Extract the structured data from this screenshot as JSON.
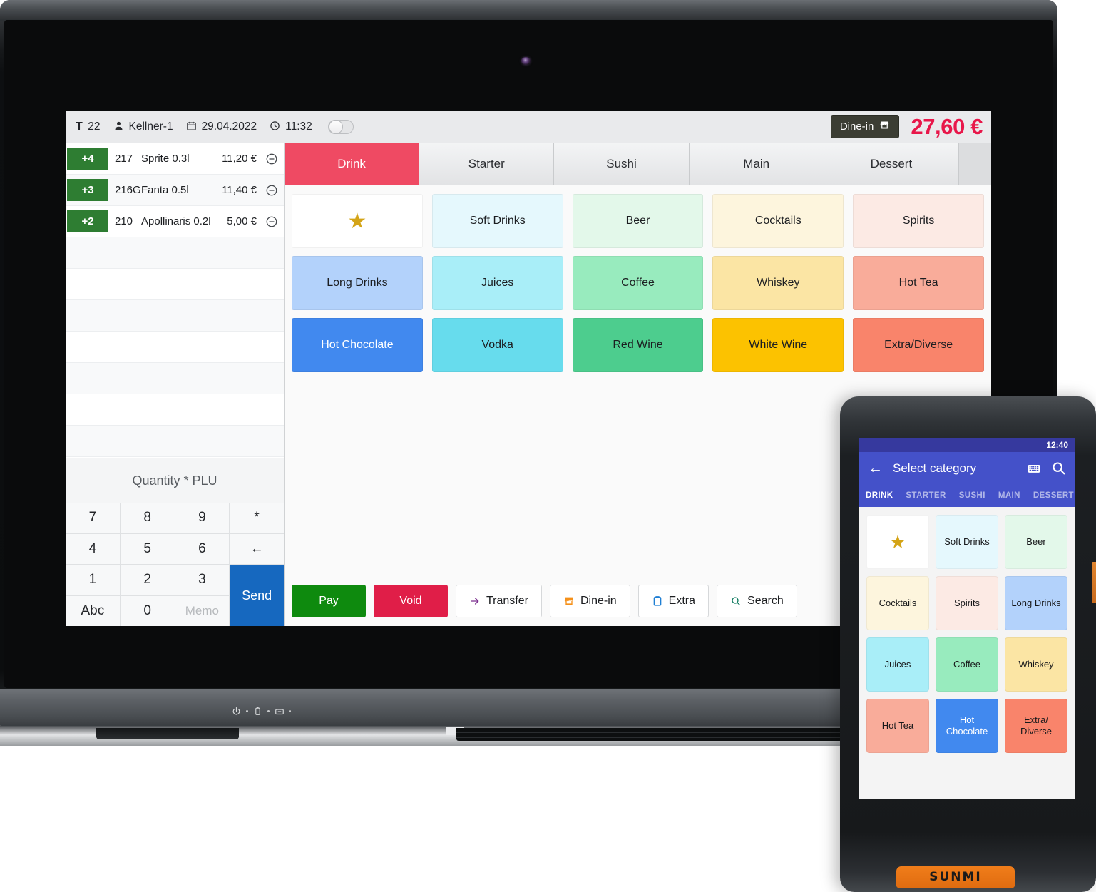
{
  "pos": {
    "header": {
      "table_label": "T",
      "table_number": "22",
      "waiter": "Kellner-1",
      "date": "29.04.2022",
      "time": "11:32",
      "toggle_state": "off",
      "order_type_badge": "Dine-in",
      "total": "27,60 €",
      "total_color": "#e8174a"
    },
    "order_items": [
      {
        "qty": "+4",
        "plu": "217",
        "name": "Sprite 0.3l",
        "price": "11,20 €"
      },
      {
        "qty": "+3",
        "plu": "216G",
        "name": "Fanta 0.5l",
        "price": "11,40 €"
      },
      {
        "qty": "+2",
        "plu": "210",
        "name": "Apollinaris 0.2l",
        "price": "5,00 €"
      }
    ],
    "empty_row_count": 7,
    "keypad": {
      "label": "Quantity * PLU",
      "keys": [
        "7",
        "8",
        "9",
        "*",
        "4",
        "5",
        "6",
        "←",
        "1",
        "2",
        "3",
        "Abc",
        "0",
        "Memo"
      ],
      "send_label": "Send",
      "send_color": "#1668bf",
      "muted_key": "Memo"
    },
    "category_tabs": [
      {
        "label": "Drink",
        "active": true
      },
      {
        "label": "Starter",
        "active": false
      },
      {
        "label": "Sushi",
        "active": false
      },
      {
        "label": "Main",
        "active": false
      },
      {
        "label": "Dessert",
        "active": false
      }
    ],
    "active_tab_color": "#ef4a63",
    "products": [
      {
        "label": "★",
        "icon": "star-icon",
        "color": "#ffffff",
        "is_star": true
      },
      {
        "label": "Soft Drinks",
        "color": "#e5f8fd"
      },
      {
        "label": "Beer",
        "color": "#e3f8ea"
      },
      {
        "label": "Cocktails",
        "color": "#fdf5dd"
      },
      {
        "label": "Spirits",
        "color": "#fceae4"
      },
      {
        "label": "Long Drinks",
        "color": "#b3d2fb"
      },
      {
        "label": "Juices",
        "color": "#a9eef8"
      },
      {
        "label": "Coffee",
        "color": "#98ebbe"
      },
      {
        "label": "Whiskey",
        "color": "#fbe5a4"
      },
      {
        "label": "Hot Tea",
        "color": "#f9ac9a"
      },
      {
        "label": "Hot Chocolate",
        "color": "#4189ef",
        "text_color": "#ffffff"
      },
      {
        "label": "Vodka",
        "color": "#67dced"
      },
      {
        "label": "Red Wine",
        "color": "#4dcd8e"
      },
      {
        "label": "White Wine",
        "color": "#fcc200"
      },
      {
        "label": "Extra/Diverse",
        "color": "#f9846b"
      }
    ],
    "actions": [
      {
        "label": "Pay",
        "style": "pay",
        "icon": ""
      },
      {
        "label": "Void",
        "style": "void",
        "icon": ""
      },
      {
        "label": "Transfer",
        "style": "plain",
        "icon": "arrow-right-icon"
      },
      {
        "label": "Dine-in",
        "style": "plain",
        "icon": "store-icon"
      },
      {
        "label": "Extra",
        "style": "plain",
        "icon": "clipboard-icon"
      },
      {
        "label": "Search",
        "style": "plain",
        "icon": "search-icon"
      }
    ]
  },
  "phone": {
    "status_time": "12:40",
    "appbar_title": "Select category",
    "appbar_icons": [
      "back-arrow-icon",
      "keyboard-icon",
      "search-icon"
    ],
    "tabs": [
      {
        "label": "DRINK",
        "active": true
      },
      {
        "label": "STARTER",
        "active": false
      },
      {
        "label": "SUSHI",
        "active": false
      },
      {
        "label": "MAIN",
        "active": false
      },
      {
        "label": "DESSERT",
        "active": false
      }
    ],
    "products": [
      {
        "label": "★",
        "icon": "star-icon",
        "color": "#ffffff",
        "is_star": true
      },
      {
        "label": "Soft Drinks",
        "color": "#e5f8fd"
      },
      {
        "label": "Beer",
        "color": "#e3f8ea"
      },
      {
        "label": "Cocktails",
        "color": "#fdf5dd"
      },
      {
        "label": "Spirits",
        "color": "#fceae4"
      },
      {
        "label": "Long Drinks",
        "color": "#b3d2fb"
      },
      {
        "label": "Juices",
        "color": "#a9eef8"
      },
      {
        "label": "Coffee",
        "color": "#98ebbe"
      },
      {
        "label": "Whiskey",
        "color": "#fbe5a4"
      },
      {
        "label": "Hot Tea",
        "color": "#f9ac9a"
      },
      {
        "label": "Hot Chocolate",
        "color": "#4189ef",
        "text_color": "#ffffff"
      },
      {
        "label": "Extra/ Diverse",
        "color": "#f9846b"
      }
    ],
    "brand": "SUNMI",
    "brand_color": "#f07d1a"
  },
  "hardware": {
    "chin_icons": [
      "power-icon",
      "battery-icon",
      "display-icon"
    ]
  }
}
